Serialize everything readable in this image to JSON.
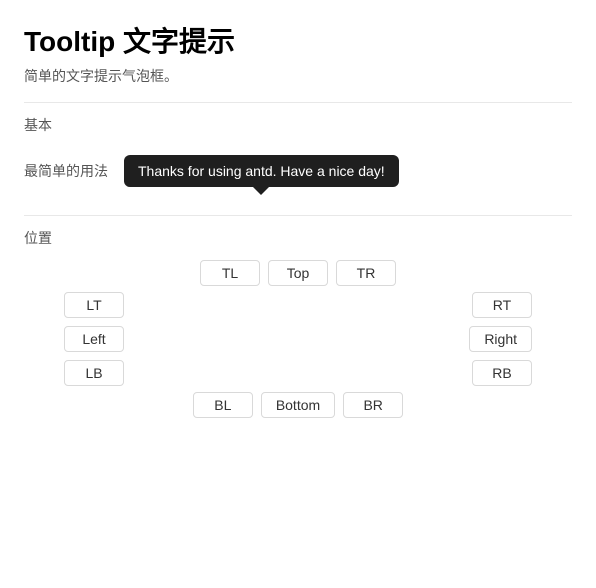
{
  "title": "Tooltip 文字提示",
  "subtitle": "简单的文字提示气泡框。",
  "sections": {
    "basic": {
      "label": "基本",
      "row_label": "最简单的用法",
      "tooltip_text": "Thanks for using antd. Have a nice day!"
    },
    "position": {
      "label": "位置",
      "buttons": {
        "top_row": [
          "TL",
          "Top",
          "TR"
        ],
        "left_col": [
          "LT",
          "Left",
          "LB"
        ],
        "right_col": [
          "RT",
          "Right",
          "RB"
        ],
        "bottom_row": [
          "BL",
          "Bottom",
          "BR"
        ]
      }
    }
  }
}
